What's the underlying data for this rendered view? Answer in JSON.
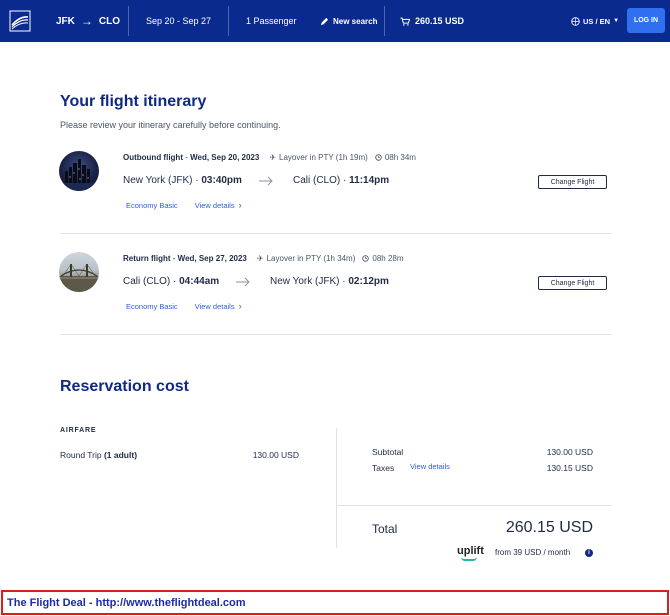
{
  "header": {
    "origin": "JFK",
    "destination": "CLO",
    "dates": "Sep 20 - Sep 27",
    "passengers": "1 Passenger",
    "new_search": "New search",
    "cart_total": "260.15 USD",
    "locale": "US / EN",
    "login": "LOG IN",
    "colors": {
      "bar": "#0b2a8e",
      "login": "#2f6ff0"
    }
  },
  "itinerary": {
    "title": "Your flight itinerary",
    "subtitle": "Please review your itinerary carefully before continuing.",
    "legs": [
      {
        "label": "Outbound flight",
        "date": "Wed, Sep 20, 2023",
        "layover": "Layover in PTY (1h 19m)",
        "duration": "08h 34m",
        "from_city": "New York (JFK)",
        "from_time": "03:40pm",
        "to_city": "Cali (CLO)",
        "to_time": "11:14pm",
        "fare": "Economy Basic",
        "details": "View details",
        "change": "Change Flight",
        "photo_icon": "new-york-skyline-photo"
      },
      {
        "label": "Return flight",
        "date": "Wed, Sep 27, 2023",
        "layover": "Layover in PTY (1h 34m)",
        "duration": "08h 28m",
        "from_city": "Cali (CLO)",
        "from_time": "04:44am",
        "to_city": "New York (JFK)",
        "to_time": "02:12pm",
        "fare": "Economy Basic",
        "details": "View details",
        "change": "Change Flight",
        "photo_icon": "cali-bridge-photo"
      }
    ]
  },
  "reservation": {
    "title": "Reservation cost",
    "section": "AIRFARE",
    "trip_label": "Round Trip",
    "trip_pax": "(1 adult)",
    "trip_price": "130.00 USD",
    "subtotal_label": "Subtotal",
    "subtotal": "130.00 USD",
    "taxes_label": "Taxes",
    "taxes_link": "View details",
    "taxes": "130.15 USD",
    "total_label": "Total",
    "total": "260.15 USD",
    "uplift_brand": "uplift",
    "uplift_text": "from 39 USD  / month"
  },
  "banner": {
    "text": "The Flight Deal - http://www.theflightdeal.com"
  }
}
